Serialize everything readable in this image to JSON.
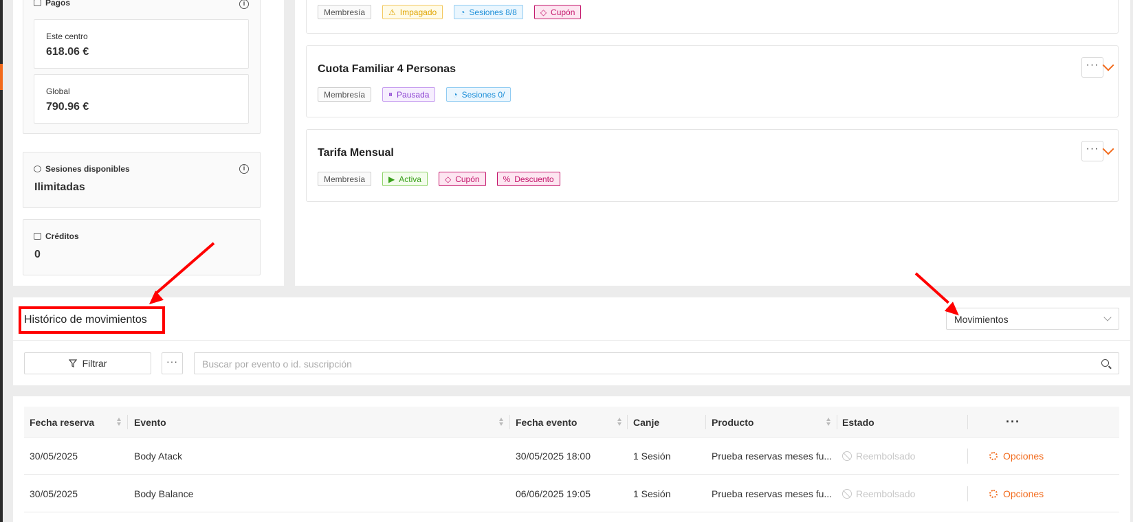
{
  "payments": {
    "title": "Pagos",
    "este_centro_label": "Este centro",
    "este_centro_value": "618.06 €",
    "global_label": "Global",
    "global_value": "790.96 €"
  },
  "sessions": {
    "title": "Sesiones disponibles",
    "value": "Ilimitadas"
  },
  "credits": {
    "title": "Créditos",
    "value": "0"
  },
  "subscriptions": [
    {
      "title": "",
      "tags": [
        "Membresía",
        "Impagado",
        "Sesiones 8/8",
        "Cupón"
      ]
    },
    {
      "title": "Cuota Familiar 4 Personas",
      "tags": [
        "Membresía",
        "Pausada",
        "Sesiones 0/"
      ]
    },
    {
      "title": "Tarifa Mensual",
      "tags": [
        "Membresía",
        "Activa",
        "Cupón",
        "Descuento"
      ]
    }
  ],
  "history": {
    "title": "Histórico de movimientos",
    "select_value": "Movimientos",
    "filter_label": "Filtrar",
    "search_placeholder": "Buscar por evento o id. suscripción"
  },
  "table": {
    "columns": [
      "Fecha reserva",
      "Evento",
      "Fecha evento",
      "Canje",
      "Producto",
      "Estado"
    ],
    "rows": [
      {
        "fecha_reserva": "30/05/2025",
        "evento": "Body Atack",
        "fecha_evento": "30/05/2025 18:00",
        "canje": "1 Sesión",
        "producto": "Prueba reservas meses fu...",
        "estado": "Reembolsado",
        "accion": "Opciones"
      },
      {
        "fecha_reserva": "30/05/2025",
        "evento": "Body Balance",
        "fecha_evento": "06/06/2025 19:05",
        "canje": "1 Sesión",
        "producto": "Prueba reservas meses fu...",
        "estado": "Reembolsado",
        "accion": "Opciones"
      }
    ]
  },
  "colors": {
    "accent": "#f26a1b",
    "annotation": "#ff0000"
  }
}
